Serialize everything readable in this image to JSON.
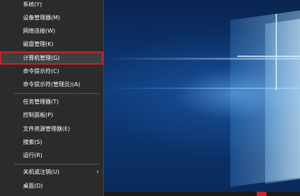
{
  "winx_menu": {
    "items": [
      {
        "label": "系统(Y)"
      },
      {
        "label": "设备管理器(M)"
      },
      {
        "label": "网络连接(W)"
      },
      {
        "label": "磁盘管理(K)"
      },
      {
        "label": "计算机管理(G)",
        "highlighted": true
      },
      {
        "label": "命令提示符(C)"
      },
      {
        "label": "命令提示符(管理员)(A)"
      },
      {
        "label": "任务管理器(T)"
      },
      {
        "label": "控制面板(P)"
      },
      {
        "label": "文件资源管理器(E)"
      },
      {
        "label": "搜索(S)"
      },
      {
        "label": "运行(R)"
      },
      {
        "label": "关机或注销(U)",
        "has_submenu": true
      },
      {
        "label": "桌面(D)"
      }
    ],
    "highlight_color": "#c4262a",
    "background_color": "#2b2b2b",
    "submenu_icon": "chevron-right-icon"
  }
}
